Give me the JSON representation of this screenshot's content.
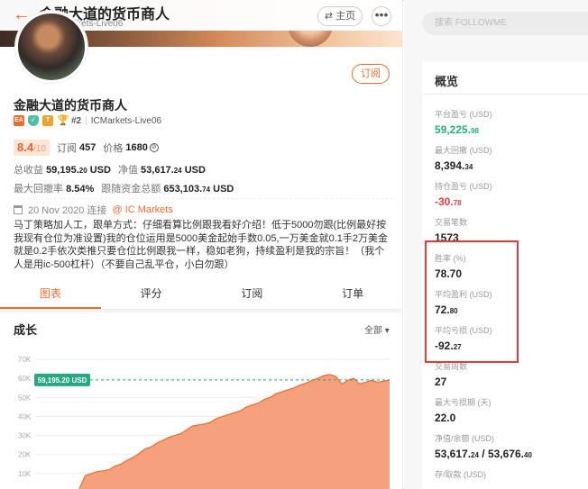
{
  "topbar": {
    "title": "金融大道的货币商人",
    "subtitle": "#2 ICMarkets-Live06",
    "home_label": "⇄ 主页",
    "more_label": "•••"
  },
  "profile": {
    "subscribe_label": "订阅",
    "name": "金融大道的货币商人",
    "badges": [
      "EA",
      "✓",
      "T",
      "🏆"
    ],
    "rank": "#2",
    "account": "ICMarkets-Live06",
    "score": "8.4",
    "score_max": "/10",
    "subs_label": "订阅",
    "subs_value": "457",
    "price_label": "价格",
    "price_value": "1680",
    "total_profit_label": "总收益",
    "total_profit_int": "59,195.",
    "total_profit_dec": "20",
    "total_profit_unit": "USD",
    "equity_label": "净值",
    "equity_int": "53,617.",
    "equity_dec": "24",
    "equity_unit": "USD",
    "drawdown_label": "最大回撤率",
    "drawdown_value": "8.54%",
    "follow_label": "跟随资金总额",
    "follow_int": "653,103.",
    "follow_dec": "74",
    "follow_unit": "USD",
    "date": "20 Nov 2020 连接",
    "broker_link": "@ IC Markets",
    "description": "马丁策略加人工，跟单方式：仔细看算比例跟我看好介绍！低于5000勿跟(比例最好按我现有仓位为准设置)我的仓位运用是5000美金起始手数0.05,一万美金就0.1手2万美金就是0.2手依次类推只要仓位比例跟我一样，稳如老狗，持续盈利是我的宗旨！（我个人是用ic-500杠杆）（不要自己乱平仓，小白勿跟）"
  },
  "tabs": [
    "图表",
    "评分",
    "订阅",
    "订单"
  ],
  "growth": {
    "title": "成长",
    "range_label": "全部 ▾"
  },
  "chart_data": {
    "type": "area",
    "ylim": [
      0,
      70000
    ],
    "y_ticks": [
      "70K",
      "60K",
      "50K",
      "40K",
      "30K",
      "20K",
      "10K"
    ],
    "y_tick_values": [
      70000,
      60000,
      50000,
      40000,
      30000,
      20000,
      10000
    ],
    "marker_label": "59,195.20 USD",
    "marker_value": 59195.2,
    "series": [
      {
        "values": [
          2000,
          9000,
          10000,
          11000,
          11500,
          12000,
          14000,
          15000,
          17000,
          18500,
          20500,
          23000,
          24000,
          26000,
          27500,
          29000,
          30000,
          31000,
          33000,
          35000,
          35500,
          36000,
          37000,
          39000,
          40000,
          41000,
          42000,
          43000,
          45000,
          46000,
          47000,
          49000,
          50000,
          52000,
          53000,
          54000,
          55000,
          56500,
          57500,
          59000,
          60000,
          61500,
          62000,
          61000,
          57000,
          59000,
          60000,
          57000,
          58000,
          59000,
          58000,
          58500,
          59195
        ]
      }
    ],
    "colors": {
      "fill": "#f7a07c",
      "line": "#f06b2b",
      "marker": "#26a882"
    }
  },
  "sidebar": {
    "search_placeholder": "搜索 FOLLOWME",
    "card_title": "概览",
    "metrics": [
      {
        "label": "平台盈亏 (USD)",
        "int": "59,225.",
        "dec": "98",
        "color": "green"
      },
      {
        "label": "最大回撤 (USD)",
        "int": "8,394.",
        "dec": "34",
        "color": ""
      },
      {
        "label": "持仓盈亏 (USD)",
        "int": "-30.",
        "dec": "78",
        "color": "red"
      },
      {
        "label": "交易笔数",
        "int": "1573",
        "dec": "",
        "color": ""
      },
      {
        "label": "胜率 (%)",
        "int": "78.70",
        "dec": "",
        "color": ""
      },
      {
        "label": "平均盈利 (USD)",
        "int": "72.",
        "dec": "80",
        "color": ""
      },
      {
        "label": "平均亏损 (USD)",
        "int": "-92.",
        "dec": "27",
        "color": ""
      },
      {
        "label": "交易周数",
        "int": "27",
        "dec": "",
        "color": ""
      },
      {
        "label": "最大亏损期 (天)",
        "int": "22.0",
        "dec": "",
        "color": ""
      },
      {
        "label": "净值/余额 (USD)",
        "int": "53,617.",
        "dec": "24",
        "extra_int": " / 53,676.",
        "extra_dec": "40",
        "color": ""
      },
      {
        "label": "存/取款 (USD)",
        "int": "",
        "dec": "",
        "color": ""
      }
    ]
  }
}
